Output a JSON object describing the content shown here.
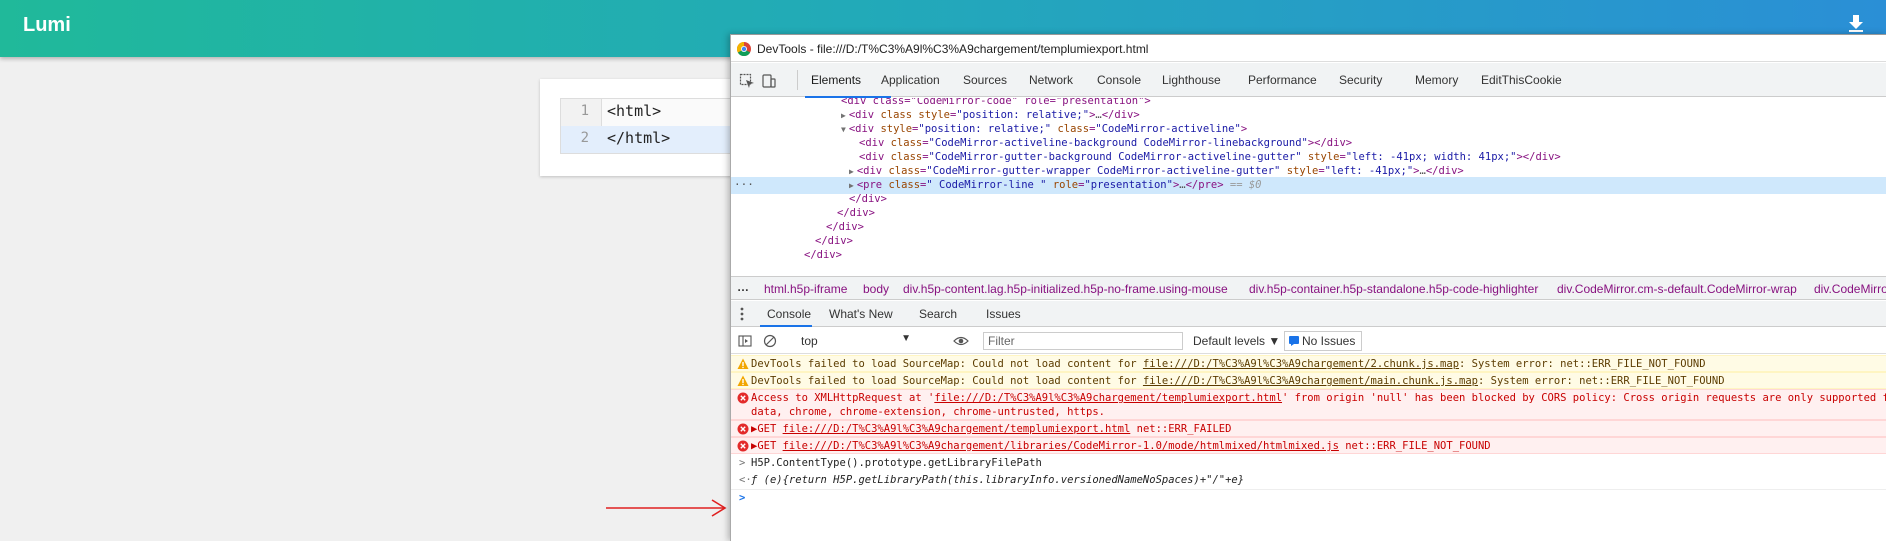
{
  "app": {
    "title": "Lumi",
    "download_icon": "download-arrow-icon",
    "header_gradient": [
      "#20b99a",
      "#2a8fd6"
    ]
  },
  "editor": {
    "lines": [
      {
        "num": "1",
        "code": "<html>"
      },
      {
        "num": "2",
        "code": "</html>"
      }
    ]
  },
  "devtools": {
    "title": "DevTools - file:///D:/T%C3%A9l%C3%A9chargement/templumiexport.html",
    "tabs": [
      "Elements",
      "Application",
      "Sources",
      "Network",
      "Console",
      "Lighthouse",
      "Performance",
      "Security",
      "Memory",
      "EditThisCookie"
    ],
    "active_tab": "Elements",
    "accent": "#1a73e8",
    "dom_tree": [
      {
        "tri": "",
        "parts": [
          [
            "tag",
            "<div class=\"CodeMirror-code\" role=\"presentation\">"
          ]
        ]
      },
      {
        "tri": "▶",
        "parts": [
          [
            "tag",
            "<div "
          ],
          [
            "attr",
            "class"
          ],
          [
            "tag",
            " "
          ],
          [
            "attr",
            "style"
          ],
          [
            "tag",
            "="
          ],
          [
            "val",
            "\"position: relative;\""
          ],
          [
            "tag",
            ">"
          ],
          [
            "dim",
            "…"
          ],
          [
            "tag",
            "</div>"
          ]
        ]
      },
      {
        "tri": "▼",
        "parts": [
          [
            "tag",
            "<div "
          ],
          [
            "attr",
            "style"
          ],
          [
            "tag",
            "="
          ],
          [
            "val",
            "\"position: relative;\""
          ],
          [
            "tag",
            " "
          ],
          [
            "attr",
            "class"
          ],
          [
            "tag",
            "="
          ],
          [
            "val",
            "\"CodeMirror-activeline\""
          ],
          [
            "tag",
            ">"
          ]
        ]
      },
      {
        "tri": "",
        "parts": [
          [
            "tag",
            "<div "
          ],
          [
            "attr",
            "class"
          ],
          [
            "tag",
            "="
          ],
          [
            "val",
            "\"CodeMirror-activeline-background CodeMirror-linebackground\""
          ],
          [
            "tag",
            "></div>"
          ]
        ]
      },
      {
        "tri": "",
        "parts": [
          [
            "tag",
            "<div "
          ],
          [
            "attr",
            "class"
          ],
          [
            "tag",
            "="
          ],
          [
            "val",
            "\"CodeMirror-gutter-background CodeMirror-activeline-gutter\""
          ],
          [
            "tag",
            " "
          ],
          [
            "attr",
            "style"
          ],
          [
            "tag",
            "="
          ],
          [
            "val",
            "\"left: -41px; width: 41px;\""
          ],
          [
            "tag",
            "></div>"
          ]
        ]
      },
      {
        "tri": "▶",
        "parts": [
          [
            "tag",
            "<div "
          ],
          [
            "attr",
            "class"
          ],
          [
            "tag",
            "="
          ],
          [
            "val",
            "\"CodeMirror-gutter-wrapper CodeMirror-activeline-gutter\""
          ],
          [
            "tag",
            " "
          ],
          [
            "attr",
            "style"
          ],
          [
            "tag",
            "="
          ],
          [
            "val",
            "\"left: -41px;\""
          ],
          [
            "tag",
            ">"
          ],
          [
            "dim",
            "…"
          ],
          [
            "tag",
            "</div>"
          ]
        ]
      },
      {
        "tri": "▶",
        "parts": [
          [
            "tag",
            "<pre "
          ],
          [
            "attr",
            "class"
          ],
          [
            "tag",
            "="
          ],
          [
            "val",
            "\" CodeMirror-line \""
          ],
          [
            "tag",
            " "
          ],
          [
            "attr",
            "role"
          ],
          [
            "tag",
            "="
          ],
          [
            "val",
            "\"presentation\""
          ],
          [
            "tag",
            ">"
          ],
          [
            "dim",
            "…"
          ],
          [
            "tag",
            "</pre>"
          ],
          [
            "eq",
            " == $0"
          ]
        ]
      },
      {
        "tri": "",
        "parts": [
          [
            "tag",
            "</div>"
          ]
        ]
      },
      {
        "tri": "",
        "parts": [
          [
            "tag",
            "</div>"
          ]
        ]
      },
      {
        "tri": "",
        "parts": [
          [
            "tag",
            "</div>"
          ]
        ]
      },
      {
        "tri": "",
        "parts": [
          [
            "tag",
            "</div>"
          ]
        ]
      },
      {
        "tri": "",
        "parts": [
          [
            "tag",
            "</div>"
          ]
        ]
      }
    ],
    "breadcrumbs": [
      "html.h5p-iframe",
      "body",
      "div.h5p-content.lag.h5p-initialized.h5p-no-frame.using-mouse",
      "div.h5p-container.h5p-standalone.h5p-code-highlighter",
      "div.CodeMirror.cm-s-default.CodeMirror-wrap",
      "div.CodeMirror-scroll"
    ],
    "drawer_tabs": [
      "Console",
      "What's New",
      "Search",
      "Issues"
    ],
    "console_toolbar": {
      "context": "top",
      "filter_placeholder": "Filter",
      "levels": "Default levels ▼",
      "issues": "No Issues"
    },
    "messages": [
      {
        "level": "warn",
        "pre": "DevTools failed to load SourceMap: Could not load content for ",
        "link": "file:///D:/T%C3%A9l%C3%A9chargement/2.chunk.js.map",
        "post": ": System error: net::ERR_FILE_NOT_FOUND"
      },
      {
        "level": "warn",
        "pre": "DevTools failed to load SourceMap: Could not load content for ",
        "link": "file:///D:/T%C3%A9l%C3%A9chargement/main.chunk.js.map",
        "post": ": System error: net::ERR_FILE_NOT_FOUND"
      },
      {
        "level": "err",
        "pre": "Access to XMLHttpRequest at '",
        "link": "file:///D:/T%C3%A9l%C3%A9chargement/templumiexport.html",
        "post": "' from origin 'null' has been blocked by CORS policy: Cross origin requests are only supported for protocol schemes: http,",
        "line2": "data, chrome, chrome-extension, chrome-untrusted, https."
      },
      {
        "level": "err",
        "pre": "▶GET ",
        "link": "file:///D:/T%C3%A9l%C3%A9chargement/templumiexport.html",
        "post": " net::ERR_FAILED"
      },
      {
        "level": "err",
        "pre": "▶GET ",
        "link": "file:///D:/T%C3%A9l%C3%A9chargement/libraries/CodeMirror-1.0/mode/htmlmixed/htmlmixed.js",
        "post": " net::ERR_FILE_NOT_FOUND"
      }
    ],
    "command": "H5P.ContentType().prototype.getLibraryFilePath",
    "result": "ƒ (e){return H5P.getLibraryPath(this.libraryInfo.versionedNameNoSpaces)+\"/\"+e}"
  }
}
